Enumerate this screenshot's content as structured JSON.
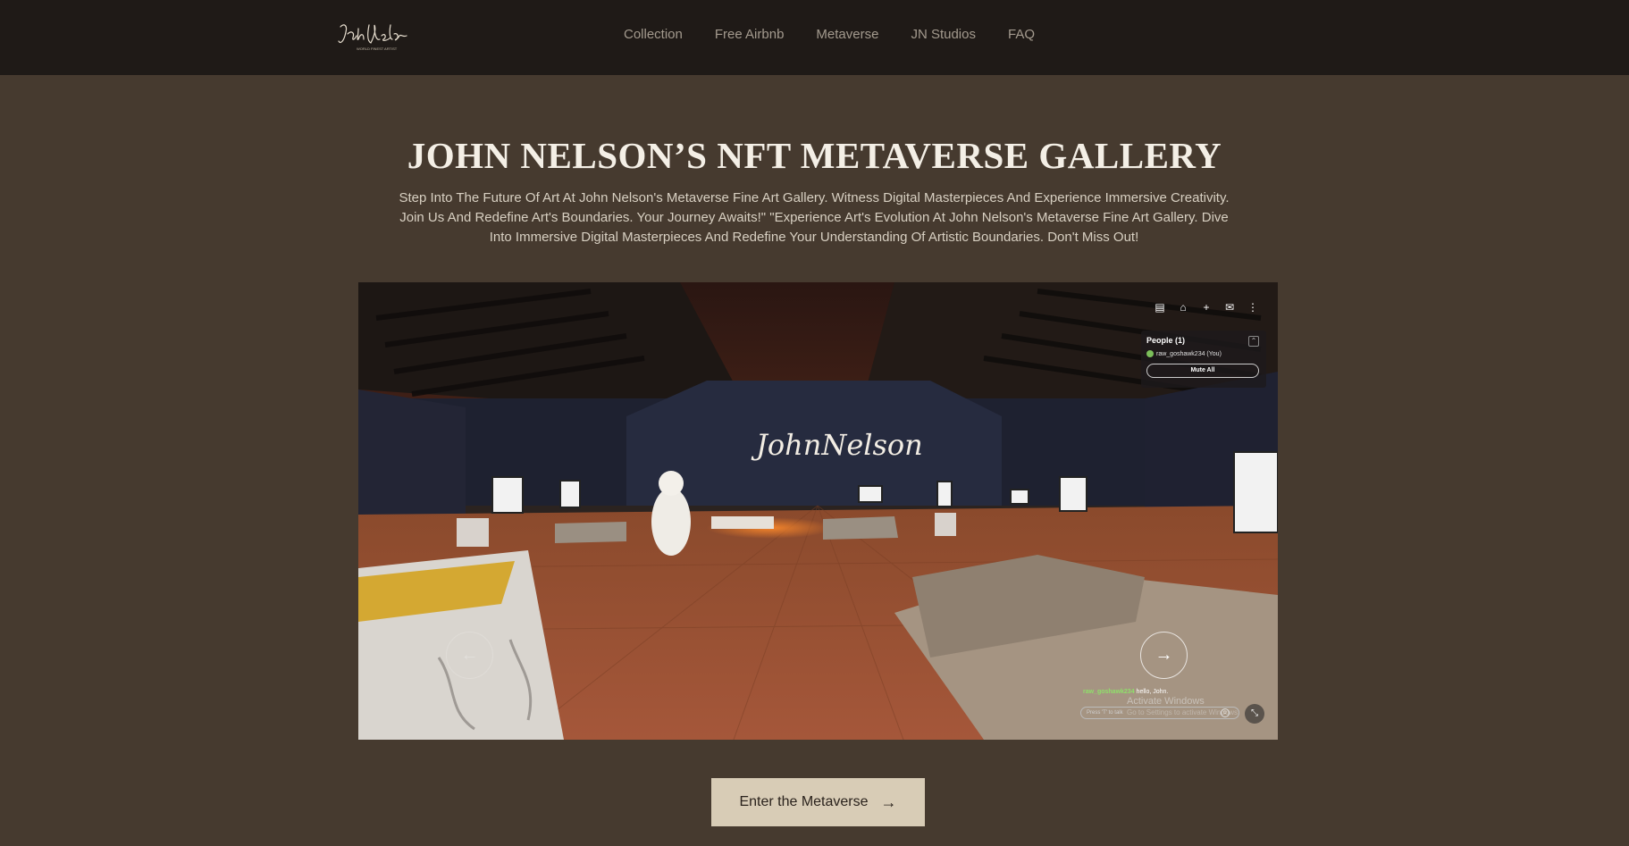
{
  "header": {
    "logo_text": "JohnNelson",
    "nav": [
      "Collection",
      "Free Airbnb",
      "Metaverse",
      "JN Studios",
      "FAQ"
    ]
  },
  "hero": {
    "title": "JOHN NELSON’S NFT METAVERSE GALLERY",
    "description": "Step Into The Future Of Art At John Nelson's Metaverse Fine Art Gallery. Witness Digital Masterpieces And Experience Immersive Creativity. Join Us And Redefine Art's Boundaries. Your Journey Awaits!\" \"Experience Art's Evolution At John Nelson's Metaverse Fine Art Gallery. Dive Into Immersive Digital Masterpieces And Redefine Your Understanding Of Artistic Boundaries. Don't Miss Out!"
  },
  "viewer": {
    "toolbar_icons": [
      "shop-icon",
      "home-icon",
      "plus-icon",
      "chat-icon",
      "more-icon"
    ],
    "people": {
      "title": "People (1)",
      "user": "raw_goshawk234 (You)",
      "mute_all": "Mute All"
    },
    "chat": {
      "user": "raw_goshawk234",
      "message": "hello, John.",
      "input_placeholder": "Press 'T' to talk"
    },
    "watermark": "Activate Windows",
    "watermark_sub": "Go to Settings to activate Windows."
  },
  "cta": {
    "label": "Enter the Metaverse"
  },
  "colors": {
    "page_bg": "#463a2f",
    "header_bg": "#1f1a17",
    "cta_bg": "#d8ccb6",
    "chat_user": "#8fe06a"
  }
}
